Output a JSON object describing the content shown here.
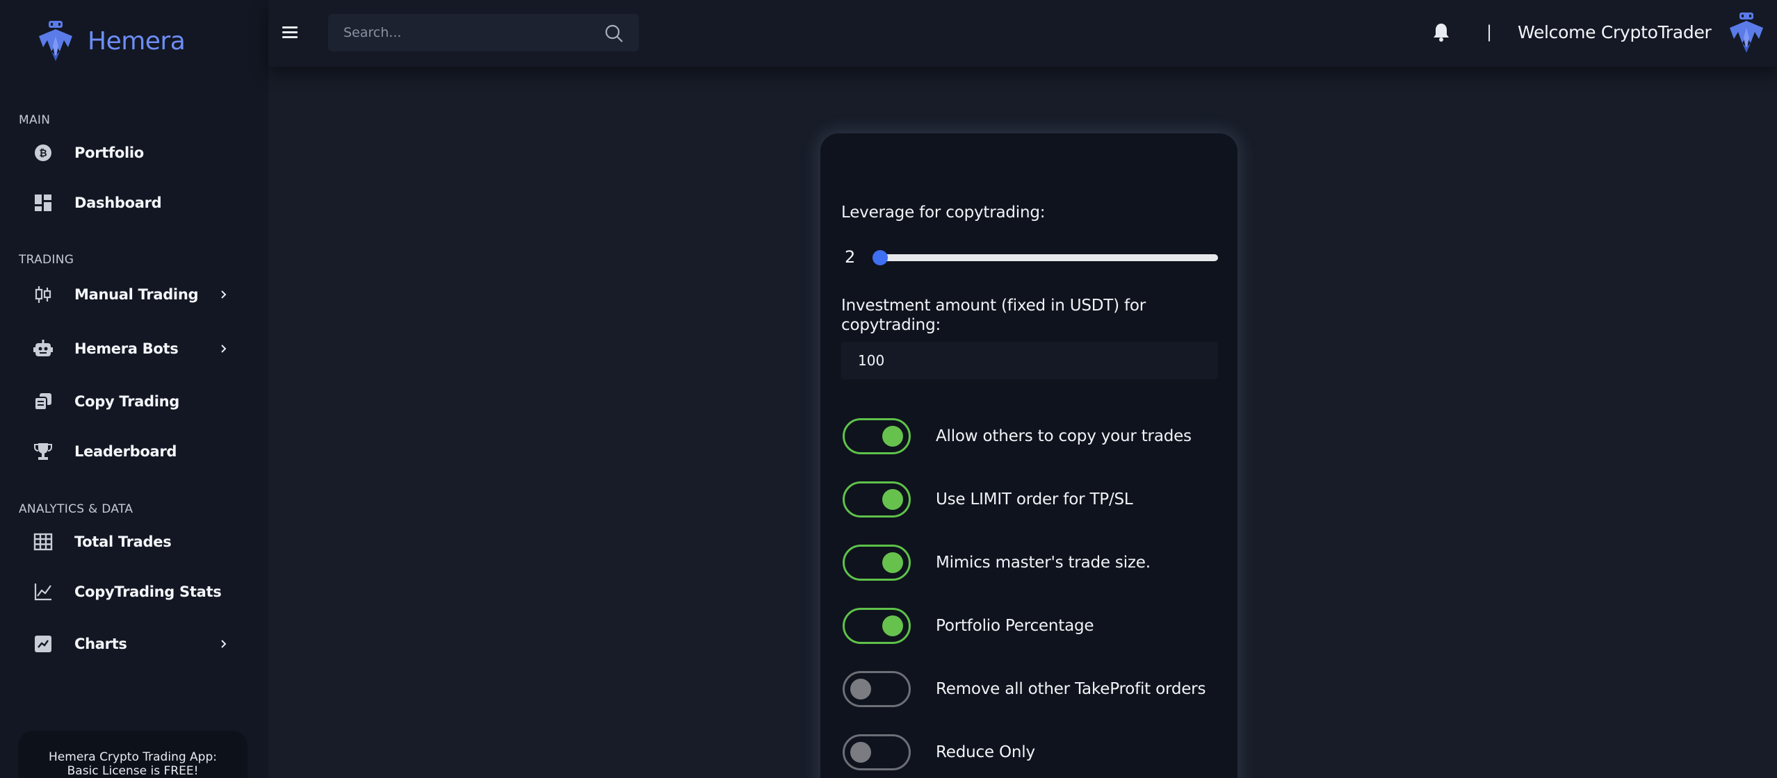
{
  "brand": {
    "name": "Hemera"
  },
  "sidebar": {
    "sections": [
      {
        "label": "MAIN"
      },
      {
        "label": "TRADING"
      },
      {
        "label": "ANALYTICS & DATA"
      }
    ],
    "items": [
      {
        "label": "Portfolio",
        "icon": "bitcoin-icon"
      },
      {
        "label": "Dashboard",
        "icon": "dashboard-icon"
      },
      {
        "label": "Manual Trading",
        "icon": "candlestick-icon",
        "has_submenu": true
      },
      {
        "label": "Hemera Bots",
        "icon": "robot-icon",
        "has_submenu": true
      },
      {
        "label": "Copy Trading",
        "icon": "copy-icon"
      },
      {
        "label": "Leaderboard",
        "icon": "trophy-icon"
      },
      {
        "label": "Total Trades",
        "icon": "table-icon"
      },
      {
        "label": "CopyTrading Stats",
        "icon": "line-chart-icon"
      },
      {
        "label": "Charts",
        "icon": "chart-box-icon",
        "has_submenu": true
      }
    ],
    "license_text_line1": "Hemera Crypto Trading App:",
    "license_text_line2": "Basic License is FREE!"
  },
  "topbar": {
    "search_placeholder": "Search...",
    "divider": "|",
    "welcome": "Welcome CryptoTrader"
  },
  "settings": {
    "leverage_label": "Leverage for copytrading:",
    "leverage_value": "2",
    "leverage_slider_fraction": 0.02,
    "investment_label_line1": "Investment amount (fixed in USDT) for",
    "investment_label_line2": "copytrading:",
    "investment_value": "100",
    "toggles": [
      {
        "label": "Allow others to copy your trades",
        "on": true
      },
      {
        "label": "Use LIMIT order for TP/SL",
        "on": true
      },
      {
        "label": "Mimics master's trade size.",
        "on": true
      },
      {
        "label": "Portfolio Percentage",
        "on": true
      },
      {
        "label": "Remove all other TakeProfit orders",
        "on": false
      },
      {
        "label": "Reduce Only",
        "on": false
      }
    ]
  },
  "colors": {
    "accent": "#6d8df6",
    "toggle_on": "#66c24d",
    "slider_thumb": "#3f6ff2",
    "background": "#171c28",
    "sidebar": "#121723"
  }
}
